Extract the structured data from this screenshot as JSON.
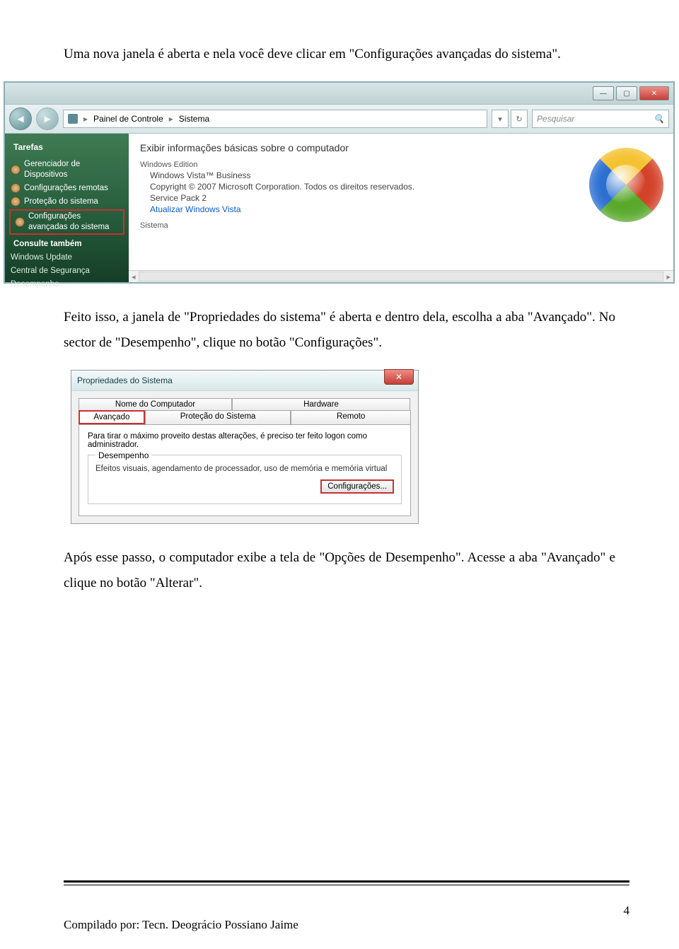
{
  "paragraphs": {
    "p1": "Uma nova janela é aberta e nela você deve clicar em \"Configurações avançadas do sistema\".",
    "p2": "Feito isso, a janela de \"Propriedades do sistema\" é aberta e dentro dela, escolha a aba \"Avançado\". No sector de \"Desempenho\", clique no botão \"Configurações\".",
    "p3": "Após esse passo, o computador exibe a tela de \"Opções de Desempenho\". Acesse a aba \"Avançado\" e clique no botão \"Alterar\"."
  },
  "shot1": {
    "addrbar": {
      "crumb1": "Painel de Controle",
      "crumb2": "Sistema"
    },
    "search_placeholder": "Pesquisar",
    "sidebar": {
      "header": "Tarefas",
      "items": [
        "Gerenciador de Dispositivos",
        "Configurações remotas",
        "Proteção do sistema",
        "Configurações avançadas do sistema"
      ],
      "section2": "Consulte também",
      "items2": [
        "Windows Update",
        "Central de Segurança",
        "Desempenho"
      ]
    },
    "content": {
      "heading": "Exibir informações básicas sobre o computador",
      "group1": "Windows Edition",
      "l1": "Windows Vista™ Business",
      "l2": "Copyright © 2007 Microsoft Corporation. Todos os direitos reservados.",
      "l3": "Service Pack 2",
      "l4": "Atualizar Windows Vista",
      "group2": "Sistema"
    }
  },
  "shot2": {
    "title": "Propriedades do Sistema",
    "tabs_row1": [
      "Nome do Computador",
      "Hardware"
    ],
    "tabs_row2": [
      "Avançado",
      "Proteção do Sistema",
      "Remoto"
    ],
    "intro": "Para tirar o máximo proveito destas alterações, é preciso ter feito logon como administrador.",
    "fieldset_legend": "Desempenho",
    "fieldset_desc": "Efeitos visuais, agendamento de processador, uso de memória e memória virtual",
    "button": "Configurações..."
  },
  "footer": {
    "author": "Compilado por: Tecn. Deográcio Possiano Jaime",
    "page": "4"
  }
}
